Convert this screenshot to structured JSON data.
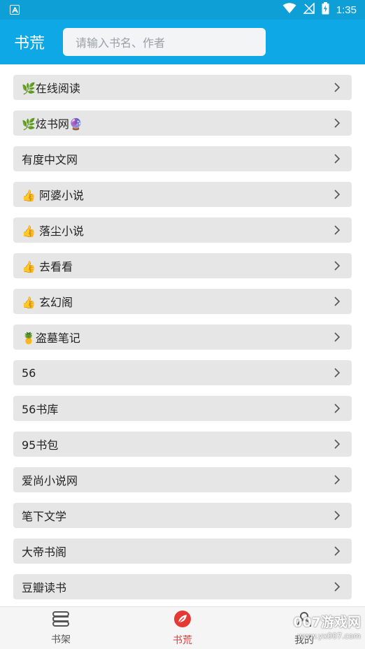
{
  "status_bar": {
    "time": "1:35",
    "icons": [
      "app-notification-icon",
      "wifi-icon",
      "signal-off-icon",
      "battery-charging-icon"
    ],
    "color": "#0e9fd7"
  },
  "toolbar": {
    "title": "书荒",
    "search_placeholder": "请输入书名、作者",
    "color": "#0ea8e6"
  },
  "sources": [
    {
      "label": "🌿在线阅读"
    },
    {
      "label": "🌿炫书网🔮"
    },
    {
      "label": "有度中文网"
    },
    {
      "label": "👍 阿婆小说"
    },
    {
      "label": "👍 落尘小说"
    },
    {
      "label": "👍 去看看"
    },
    {
      "label": "👍 玄幻阁"
    },
    {
      "label": "🍍盗墓笔记"
    },
    {
      "label": "56"
    },
    {
      "label": "56书库"
    },
    {
      "label": "95书包"
    },
    {
      "label": "爱尚小说网"
    },
    {
      "label": "笔下文学"
    },
    {
      "label": "大帝书阁"
    },
    {
      "label": "豆瓣读书"
    }
  ],
  "bottom_nav": {
    "items": [
      {
        "label": "书架",
        "icon": "bookshelf-icon",
        "active": false
      },
      {
        "label": "书荒",
        "icon": "leaf-icon",
        "active": true
      },
      {
        "label": "我的",
        "icon": "person-icon",
        "active": false
      }
    ],
    "active_color": "#e53935"
  },
  "watermark": {
    "line1": "007游戏网",
    "line2": "www.yx007.com"
  }
}
